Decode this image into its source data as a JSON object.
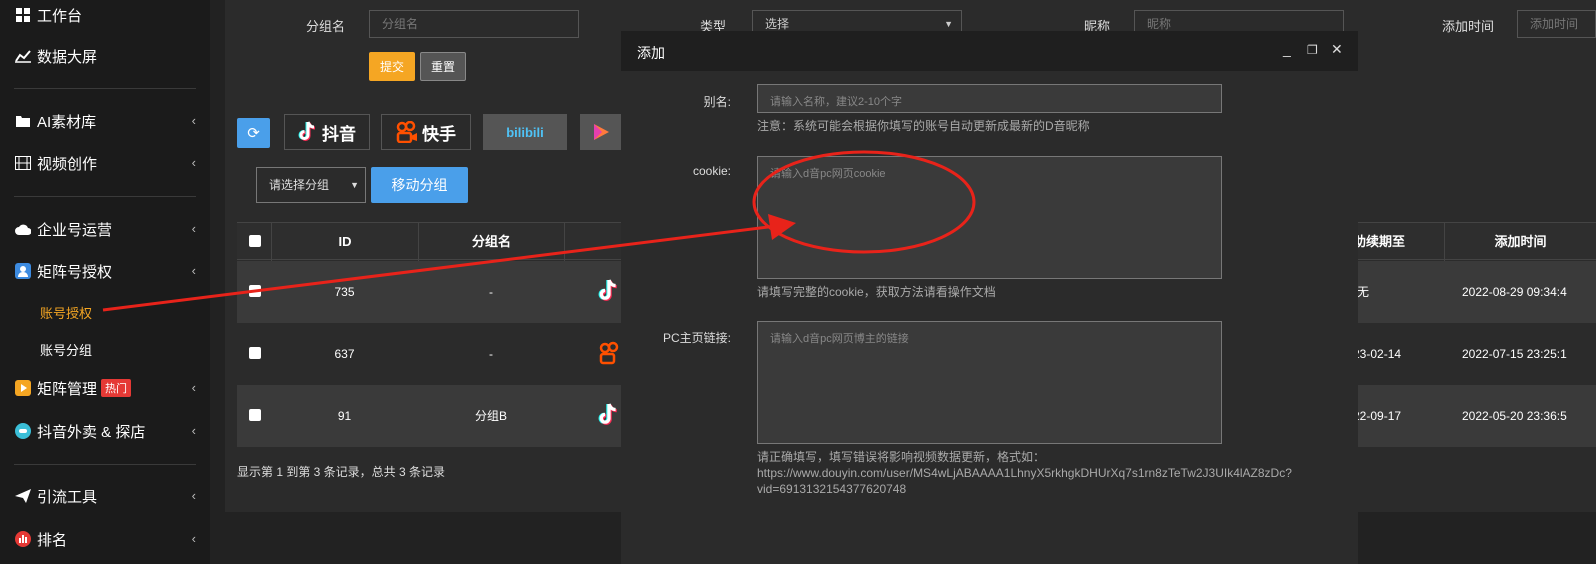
{
  "sidebar": {
    "workbench": "工作台",
    "data_screen": "数据大屏",
    "ai_library": "AI素材库",
    "video_creation": "视频创作",
    "enterprise_ops": "企业号运营",
    "matrix_auth": "矩阵号授权",
    "account_auth": "账号授权",
    "account_group": "账号分组",
    "matrix_manage": "矩阵管理",
    "hot_badge": "热门",
    "douyin_takeout": "抖音外卖 & 探店",
    "traffic_tools": "引流工具",
    "ranking": "排名"
  },
  "filters": {
    "group_label": "分组名",
    "group_placeholder": "分组名",
    "type_label": "类型",
    "type_value": "选择",
    "nickname_label": "昵称",
    "nickname_placeholder": "昵称",
    "addtime_label": "添加时间",
    "addtime_placeholder": "添加时间",
    "submit": "提交",
    "reset": "重置"
  },
  "platforms": {
    "douyin": "抖音",
    "kuaishou": "快手",
    "bilibili": "bilibili"
  },
  "toolbar": {
    "select_group": "请选择分组",
    "move_group": "移动分组"
  },
  "table": {
    "headers": {
      "id": "ID",
      "group": "分组名",
      "expire": "助续期至",
      "addtime": "添加时间"
    },
    "rows": [
      {
        "id": "735",
        "group": "-",
        "platform": "douyin",
        "expire": "无",
        "addtime": "2022-08-29 09:34:4"
      },
      {
        "id": "637",
        "group": "-",
        "platform": "kuaishou",
        "expire": "23-02-14",
        "addtime": "2022-07-15 23:25:1"
      },
      {
        "id": "91",
        "group": "分组B",
        "platform": "douyin",
        "expire": "22-09-17",
        "addtime": "2022-05-20 23:36:5"
      }
    ],
    "footer": "显示第 1 到第 3 条记录，总共 3 条记录"
  },
  "modal": {
    "title": "添加",
    "alias_label": "别名:",
    "alias_placeholder": "请输入名称，建议2-10个字",
    "alias_hint": "注意：系统可能会根据你填写的账号自动更新成最新的D音昵称",
    "cookie_label": "cookie:",
    "cookie_placeholder": "请输入d音pc网页cookie",
    "cookie_hint": "请填写完整的cookie，获取方法请看操作文档",
    "pc_link_label": "PC主页链接:",
    "pc_link_placeholder": "请输入d音pc网页博主的链接",
    "pc_link_hint_1": "请正确填写，填写错误将影响视频数据更新，格式如：",
    "pc_link_hint_2": "https://www.douyin.com/user/MS4wLjABAAAA1LhnyX5rkhgkDHUrXq7s1rn8zTeTw2J3UIk4lAZ8zDc?",
    "pc_link_hint_3": "vid=6913132154377620748"
  },
  "colors": {
    "accent_orange": "#f5a623",
    "accent_blue": "#4a9fea",
    "annotation_red": "#e8231a"
  }
}
